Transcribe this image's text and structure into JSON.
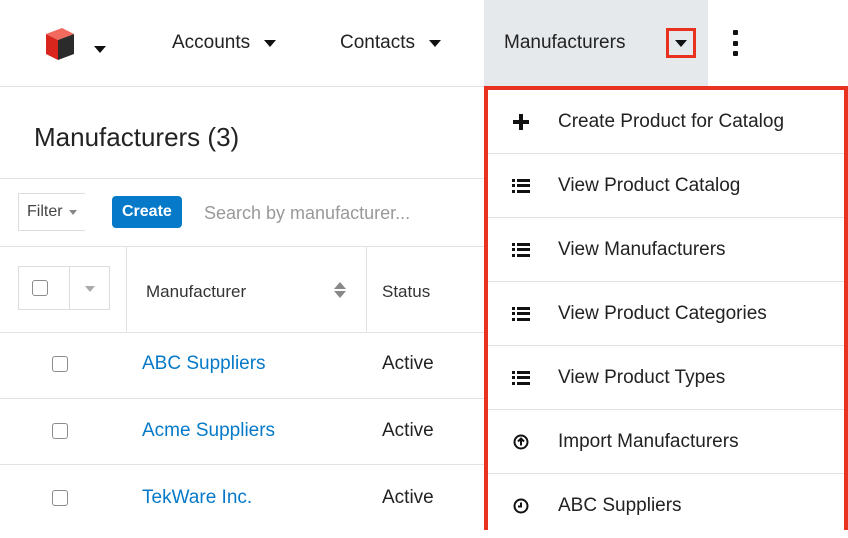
{
  "nav": {
    "items": [
      {
        "label": "Accounts"
      },
      {
        "label": "Contacts"
      },
      {
        "label": "Manufacturers"
      }
    ]
  },
  "list": {
    "title": "Manufacturers (3)",
    "filter_label": "Filter",
    "create_label": "Create",
    "search_placeholder": "Search by manufacturer...",
    "columns": [
      "Manufacturer",
      "Status"
    ],
    "rows": [
      {
        "name": "ABC Suppliers",
        "status": "Active"
      },
      {
        "name": "Acme Suppliers",
        "status": "Active"
      },
      {
        "name": "TekWare Inc.",
        "status": "Active"
      }
    ]
  },
  "dropdown": {
    "items": [
      {
        "label": "Create Product for Catalog",
        "icon": "plus-icon"
      },
      {
        "label": "View Product Catalog",
        "icon": "list-icon"
      },
      {
        "label": "View Manufacturers",
        "icon": "list-icon"
      },
      {
        "label": "View Product Categories",
        "icon": "list-icon"
      },
      {
        "label": "View Product Types",
        "icon": "list-icon"
      },
      {
        "label": "Import Manufacturers",
        "icon": "import-icon"
      },
      {
        "label": "ABC Suppliers",
        "icon": "recent-icon"
      }
    ]
  },
  "colors": {
    "highlight": "#e8321f",
    "link": "#0679c8",
    "create_button": "#0679c8",
    "active_tab_bg": "#e6e9ec"
  }
}
